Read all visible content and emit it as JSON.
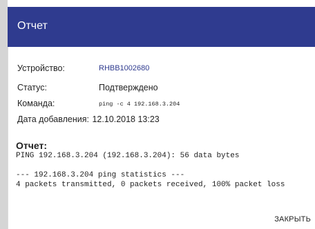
{
  "dialog": {
    "title": "Отчет",
    "header_color": "#2f3b8f",
    "device_label": "Устройство:",
    "device_value": "RHBB1002680",
    "status_label": "Статус:",
    "status_value": "Подтверждено",
    "command_label": "Команда:",
    "command_value": "ping -c 4 192.168.3.204",
    "date_label": "Дата добавления:",
    "date_value": "12.10.2018 13:23",
    "report_heading": "Отчет:",
    "report_lines": [
      "PING 192.168.3.204 (192.168.3.204): 56 data bytes",
      "",
      "--- 192.168.3.204 ping statistics ---",
      "4 packets transmitted, 0 packets received, 100% packet loss"
    ],
    "close_label": "ЗАКРЫТЬ"
  }
}
